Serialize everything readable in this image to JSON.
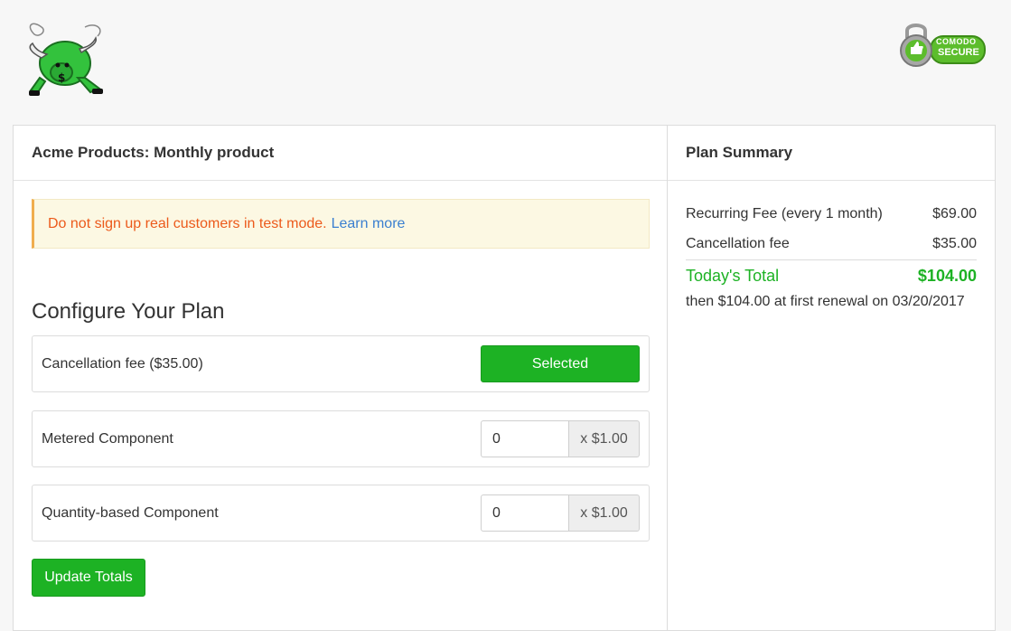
{
  "header": {
    "logo": "bull-logo",
    "badge_line1": "COMODO",
    "badge_line2": "SECURE"
  },
  "main": {
    "title": "Acme Products: Monthly product",
    "alert": {
      "text": "Do not sign up real customers in test mode.",
      "link": "Learn more"
    },
    "configure_title": "Configure Your Plan",
    "components": [
      {
        "label": "Cancellation fee ($35.00)",
        "action": "Selected"
      },
      {
        "label": "Metered Component",
        "value": "0",
        "unit": "x $1.00"
      },
      {
        "label": "Quantity-based Component",
        "value": "0",
        "unit": "x $1.00"
      }
    ],
    "update_button": "Update Totals"
  },
  "summary": {
    "title": "Plan Summary",
    "lines": [
      {
        "label": "Recurring Fee (every 1 month)",
        "amount": "$69.00"
      },
      {
        "label": "Cancellation fee",
        "amount": "$35.00"
      }
    ],
    "total_label": "Today's Total",
    "total_amount": "$104.00",
    "renewal_note": "then $104.00 at first renewal on 03/20/2017"
  },
  "colors": {
    "accent_green": "#1db224",
    "warning_orange": "#ec5a1b",
    "link_blue": "#3a7fd0",
    "alert_bg": "#fcf8e3"
  }
}
